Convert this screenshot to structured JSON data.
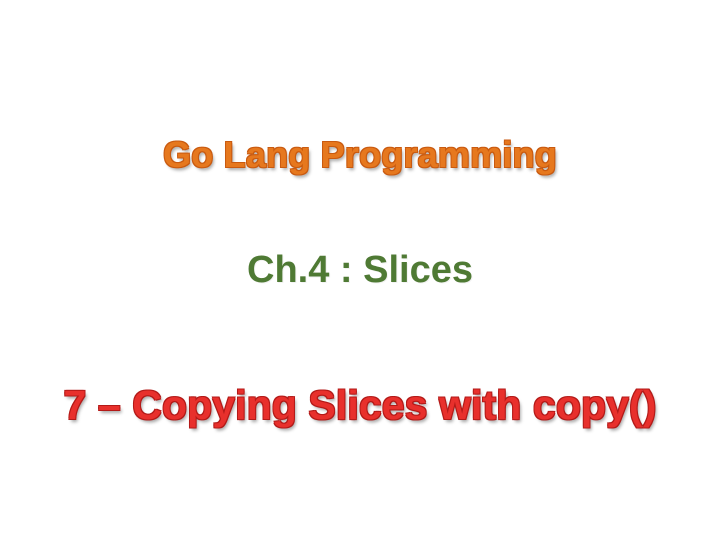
{
  "slide": {
    "title": "Go Lang Programming",
    "chapter": "Ch.4 : Slices",
    "subtitle": "7 – Copying Slices with copy()"
  },
  "colors": {
    "title": "#e6781e",
    "chapter": "#4f7a34",
    "subtitle": "#e8302c",
    "background": "#ffffff"
  }
}
